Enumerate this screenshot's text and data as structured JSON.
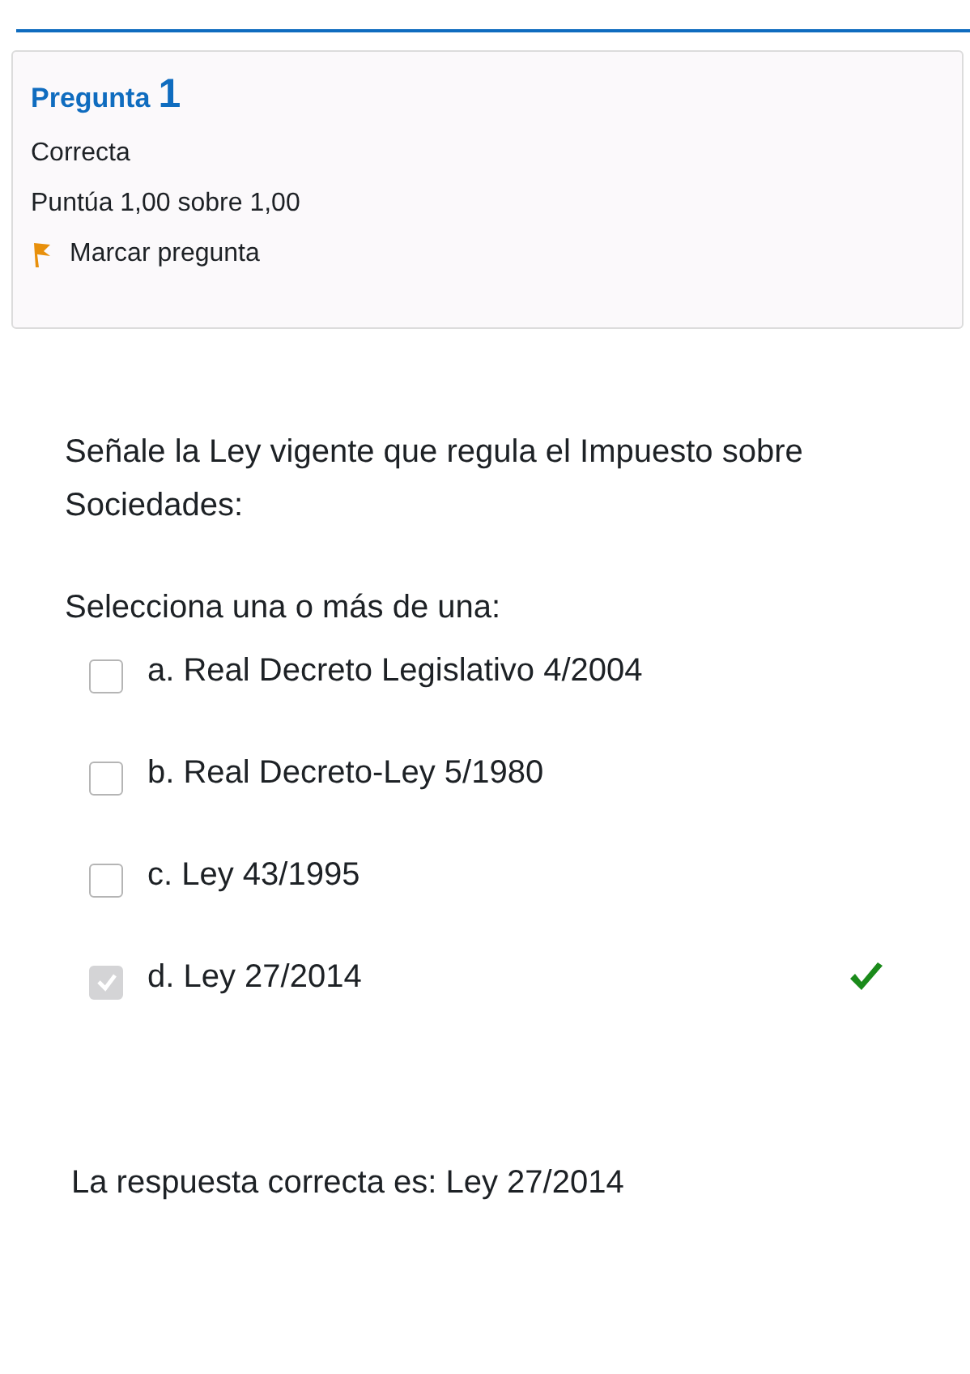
{
  "info": {
    "label": "Pregunta",
    "number": "1",
    "state": "Correcta",
    "grade": "Puntúa 1,00 sobre 1,00",
    "flag": "Marcar pregunta"
  },
  "question": {
    "text": "Señale la Ley vigente que regula el Impuesto sobre Sociedades:",
    "prompt": "Selecciona una o más de una:",
    "options": [
      {
        "text": "a. Real Decreto Legislativo 4/2004",
        "checked": false,
        "correct": false
      },
      {
        "text": "b. Real Decreto-Ley 5/1980",
        "checked": false,
        "correct": false
      },
      {
        "text": "c. Ley 43/1995",
        "checked": false,
        "correct": false
      },
      {
        "text": "d. Ley 27/2014",
        "checked": true,
        "correct": true
      }
    ]
  },
  "feedback": "La respuesta correcta es: Ley 27/2014"
}
